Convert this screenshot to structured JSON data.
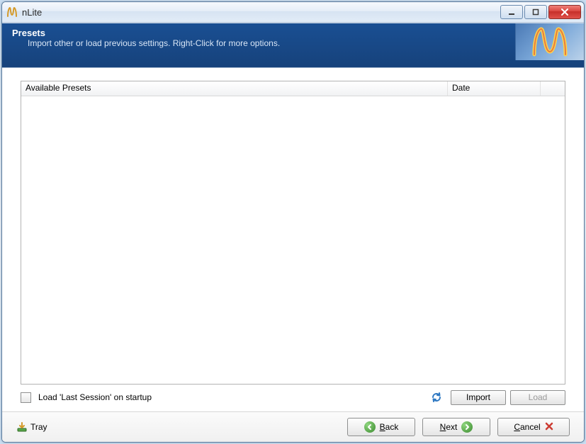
{
  "window": {
    "title": "nLite"
  },
  "banner": {
    "heading": "Presets",
    "subheading": "Import other or load previous settings. Right-Click for more options."
  },
  "listview": {
    "columns": {
      "c1": "Available Presets",
      "c2": "Date",
      "c3": ""
    },
    "rows": []
  },
  "options": {
    "load_last_session_label": "Load 'Last Session' on startup",
    "load_last_session_checked": false
  },
  "buttons": {
    "import": "Import",
    "load": "Load",
    "back": "Back",
    "next": "Next",
    "cancel": "Cancel",
    "tray": "Tray"
  },
  "icons": {
    "app": "n",
    "refresh": "refresh",
    "back_arrow": "⟵",
    "next_arrow": "⟶",
    "cancel_x": "✕",
    "tray": "⬇"
  },
  "colors": {
    "banner_bg": "#16427b",
    "close_bg": "#d9463f",
    "back_circle": "#58a94a",
    "next_circle": "#58a94a",
    "cancel_x": "#cc3c33"
  }
}
